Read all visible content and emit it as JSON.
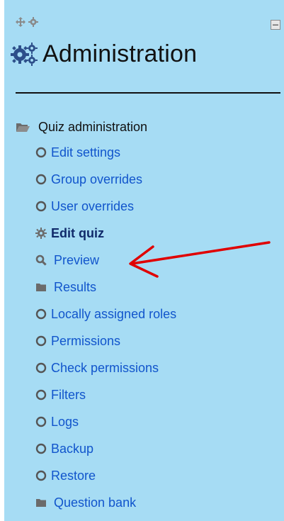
{
  "block": {
    "title": "Administration",
    "section": {
      "label": "Quiz administration",
      "icon": "folder-open-icon"
    },
    "items": [
      {
        "label": "Edit settings",
        "icon": "circle-icon",
        "bold": false
      },
      {
        "label": "Group overrides",
        "icon": "circle-icon",
        "bold": false
      },
      {
        "label": "User overrides",
        "icon": "circle-icon",
        "bold": false
      },
      {
        "label": "Edit quiz",
        "icon": "gear-icon",
        "bold": true
      },
      {
        "label": "Preview",
        "icon": "magnifier-icon",
        "bold": false
      },
      {
        "label": "Results",
        "icon": "folder-icon",
        "bold": false
      },
      {
        "label": "Locally assigned roles",
        "icon": "circle-icon",
        "bold": false
      },
      {
        "label": "Permissions",
        "icon": "circle-icon",
        "bold": false
      },
      {
        "label": "Check permissions",
        "icon": "circle-icon",
        "bold": false
      },
      {
        "label": "Filters",
        "icon": "circle-icon",
        "bold": false
      },
      {
        "label": "Logs",
        "icon": "circle-icon",
        "bold": false
      },
      {
        "label": "Backup",
        "icon": "circle-icon",
        "bold": false
      },
      {
        "label": "Restore",
        "icon": "circle-icon",
        "bold": false
      },
      {
        "label": "Question bank",
        "icon": "folder-icon",
        "bold": false
      }
    ]
  },
  "colors": {
    "panel_background": "#a6dcf4",
    "link": "#1155cc",
    "annotation_arrow": "#e00000"
  }
}
